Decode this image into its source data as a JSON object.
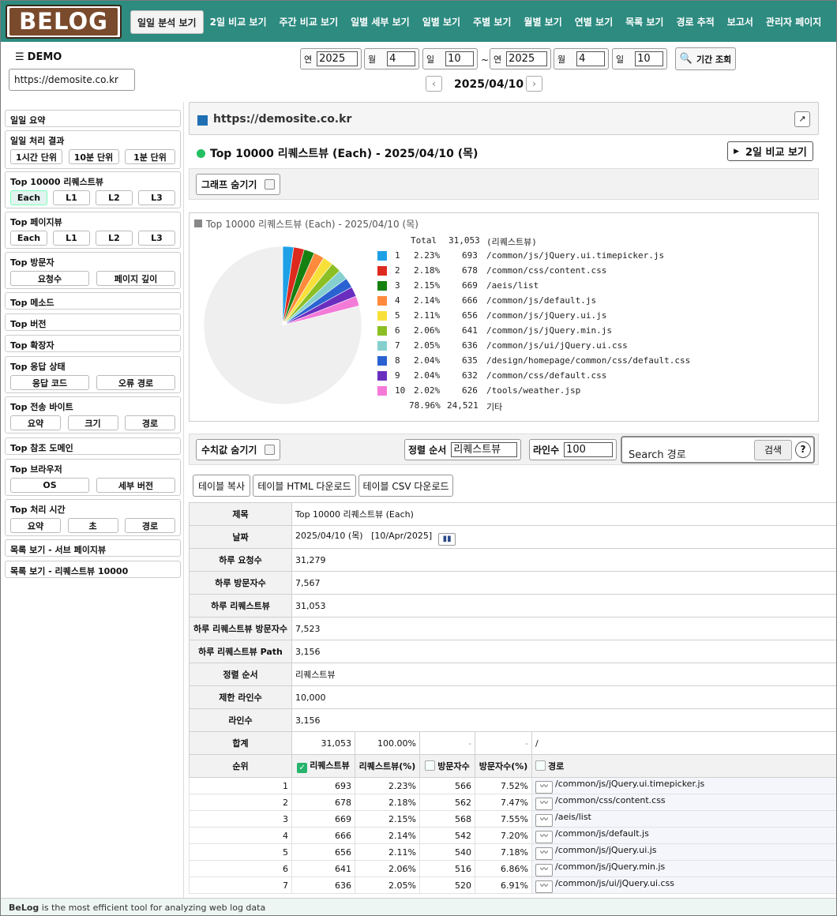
{
  "logo": {
    "text": "BELOG"
  },
  "nav": [
    "일일 분석 보기",
    "2일 비교 보기",
    "주간 비교 보기",
    "일별 세부 보기",
    "일별 보기",
    "주별 보기",
    "월별 보기",
    "연별 보기",
    "목록 보기",
    "경로 추적",
    "보고서",
    "관리자 페이지"
  ],
  "header": {
    "brand": "DEMO",
    "site": "https://demosite.co.kr",
    "from": {
      "year_label": "연",
      "year": "2025",
      "month_label": "월",
      "month": "4",
      "day_label": "일",
      "day": "10"
    },
    "to": {
      "year_label": "연",
      "year": "2025",
      "month_label": "월",
      "month": "4",
      "day_label": "일",
      "day": "10"
    },
    "tilde": "~",
    "query_label": "기간 조회",
    "current_date": "2025/04/10",
    "prev": "‹",
    "next": "›"
  },
  "sidebar": {
    "daily_summary": "일일 요약",
    "daily_result": {
      "title": "일일 처리 결과",
      "buttons": [
        "1시간 단위",
        "10분 단위",
        "1분 단위"
      ]
    },
    "top_request": {
      "title": "Top 10000 리퀘스트뷰",
      "buttons": [
        "Each",
        "L1",
        "L2",
        "L3"
      ]
    },
    "top_page": {
      "title": "Top 페이지뷰",
      "buttons": [
        "Each",
        "L1",
        "L2",
        "L3"
      ]
    },
    "top_visitor": {
      "title": "Top 방문자",
      "buttons": [
        "요청수",
        "페이지 깊이"
      ]
    },
    "top_method": "Top 메소드",
    "top_version": "Top 버전",
    "top_ext": "Top 확장자",
    "top_status": {
      "title": "Top 응답 상태",
      "buttons": [
        "응답 코드",
        "오류 경로"
      ]
    },
    "top_bytes": {
      "title": "Top 전송 바이트",
      "buttons": [
        "요약",
        "크기",
        "경로"
      ]
    },
    "top_ref": "Top 참조 도메인",
    "top_browser": {
      "title": "Top 브라우저",
      "buttons": [
        "OS",
        "세부 버전"
      ]
    },
    "top_time": {
      "title": "Top 처리 시간",
      "buttons": [
        "요약",
        "초",
        "경로"
      ]
    },
    "list_sub": "목록 보기 - 서브 페이지뷰",
    "list_req": "목록 보기 - 리퀘스트뷰 10000"
  },
  "main": {
    "site_title": "https://demosite.co.kr",
    "section_title": "Top 10000 리퀘스트뷰 (Each) - 2025/04/10 (목)",
    "compare_btn": "2일 비교 보기",
    "hide_graph": "그래프 숨기기",
    "hide_values": "수치값 숨기기",
    "sort_label": "정렬 순서",
    "sort_value": "리퀘스트뷰",
    "lines_label": "라인수",
    "lines_value": "100",
    "search_placeholder": "Search 경로",
    "search_btn": "검색",
    "help": "?",
    "copy_btn": "테이블 복사",
    "html_btn": "테이블 HTML 다운로드",
    "csv_btn": "테이블 CSV 다운로드"
  },
  "chart_data": {
    "type": "pie",
    "title": "Top 10000 리퀘스트뷰 (Each) - 2025/04/10 (목)",
    "total_label": "Total",
    "total": "31,053",
    "unit": "(리퀘스트뷰)",
    "colors": [
      "#1ea0e6",
      "#dd2a1e",
      "#168010",
      "#ff8a3c",
      "#f8e03a",
      "#8cbf24",
      "#85d0ce",
      "#2a62d2",
      "#6a2ebf",
      "#f47ad8"
    ],
    "other_color": "#efefef",
    "slices": [
      {
        "rank": "1",
        "pct": 2.23,
        "pct_label": "2.23%",
        "value": "693",
        "path": "/common/js/jQuery.ui.timepicker.js"
      },
      {
        "rank": "2",
        "pct": 2.18,
        "pct_label": "2.18%",
        "value": "678",
        "path": "/common/css/content.css"
      },
      {
        "rank": "3",
        "pct": 2.15,
        "pct_label": "2.15%",
        "value": "669",
        "path": "/aeis/list"
      },
      {
        "rank": "4",
        "pct": 2.14,
        "pct_label": "2.14%",
        "value": "666",
        "path": "/common/js/default.js"
      },
      {
        "rank": "5",
        "pct": 2.11,
        "pct_label": "2.11%",
        "value": "656",
        "path": "/common/js/jQuery.ui.js"
      },
      {
        "rank": "6",
        "pct": 2.06,
        "pct_label": "2.06%",
        "value": "641",
        "path": "/common/js/jQuery.min.js"
      },
      {
        "rank": "7",
        "pct": 2.05,
        "pct_label": "2.05%",
        "value": "636",
        "path": "/common/js/ui/jQuery.ui.css"
      },
      {
        "rank": "8",
        "pct": 2.04,
        "pct_label": "2.04%",
        "value": "635",
        "path": "/design/homepage/common/css/default.css"
      },
      {
        "rank": "9",
        "pct": 2.04,
        "pct_label": "2.04%",
        "value": "632",
        "path": "/common/css/default.css"
      },
      {
        "rank": "10",
        "pct": 2.02,
        "pct_label": "2.02%",
        "value": "626",
        "path": "/tools/weather.jsp"
      }
    ],
    "other": {
      "pct": 78.96,
      "pct_label": "78.96%",
      "value": "24,521",
      "label": "기타"
    }
  },
  "info": [
    {
      "k": "제목",
      "v": "Top 10000 리퀘스트뷰 (Each)"
    },
    {
      "k": "날짜",
      "v": "2025/04/10 (목)   [10/Apr/2025]"
    },
    {
      "k": "하루 요청수",
      "v": "31,279"
    },
    {
      "k": "하루 방문자수",
      "v": "7,567"
    },
    {
      "k": "하루 리퀘스트뷰",
      "v": "31,053"
    },
    {
      "k": "하루 리퀘스트뷰 방문자수",
      "v": "7,523"
    },
    {
      "k": "하루 리퀘스트뷰 Path",
      "v": "3,156"
    },
    {
      "k": "정렬 순서",
      "v": "리퀘스트뷰"
    },
    {
      "k": "제한 라인수",
      "v": "10,000"
    },
    {
      "k": "라인수",
      "v": "3,156"
    }
  ],
  "sum_row": {
    "k": "합계",
    "req": "31,053",
    "req_pct": "100.00%",
    "vis": "-",
    "vis_pct": "-",
    "path": "/"
  },
  "col_headers": {
    "rank": "순위",
    "req": "리퀘스트뷰",
    "req_pct": "리퀘스트뷰(%)",
    "vis": "방문자수",
    "vis_pct": "방문자수(%)",
    "path": "경로"
  },
  "rows": [
    {
      "rank": "1",
      "req": "693",
      "req_pct": "2.23%",
      "vis": "566",
      "vis_pct": "7.52%",
      "path": "/common/js/jQuery.ui.timepicker.js"
    },
    {
      "rank": "2",
      "req": "678",
      "req_pct": "2.18%",
      "vis": "562",
      "vis_pct": "7.47%",
      "path": "/common/css/content.css"
    },
    {
      "rank": "3",
      "req": "669",
      "req_pct": "2.15%",
      "vis": "568",
      "vis_pct": "7.55%",
      "path": "/aeis/list"
    },
    {
      "rank": "4",
      "req": "666",
      "req_pct": "2.14%",
      "vis": "542",
      "vis_pct": "7.20%",
      "path": "/common/js/default.js"
    },
    {
      "rank": "5",
      "req": "656",
      "req_pct": "2.11%",
      "vis": "540",
      "vis_pct": "7.18%",
      "path": "/common/js/jQuery.ui.js"
    },
    {
      "rank": "6",
      "req": "641",
      "req_pct": "2.06%",
      "vis": "516",
      "vis_pct": "6.86%",
      "path": "/common/js/jQuery.min.js"
    },
    {
      "rank": "7",
      "req": "636",
      "req_pct": "2.05%",
      "vis": "520",
      "vis_pct": "6.91%",
      "path": "/common/js/ui/jQuery.ui.css"
    }
  ],
  "footer": {
    "brand": "BeLog",
    "text": "is the most efficient tool for analyzing web log data"
  }
}
